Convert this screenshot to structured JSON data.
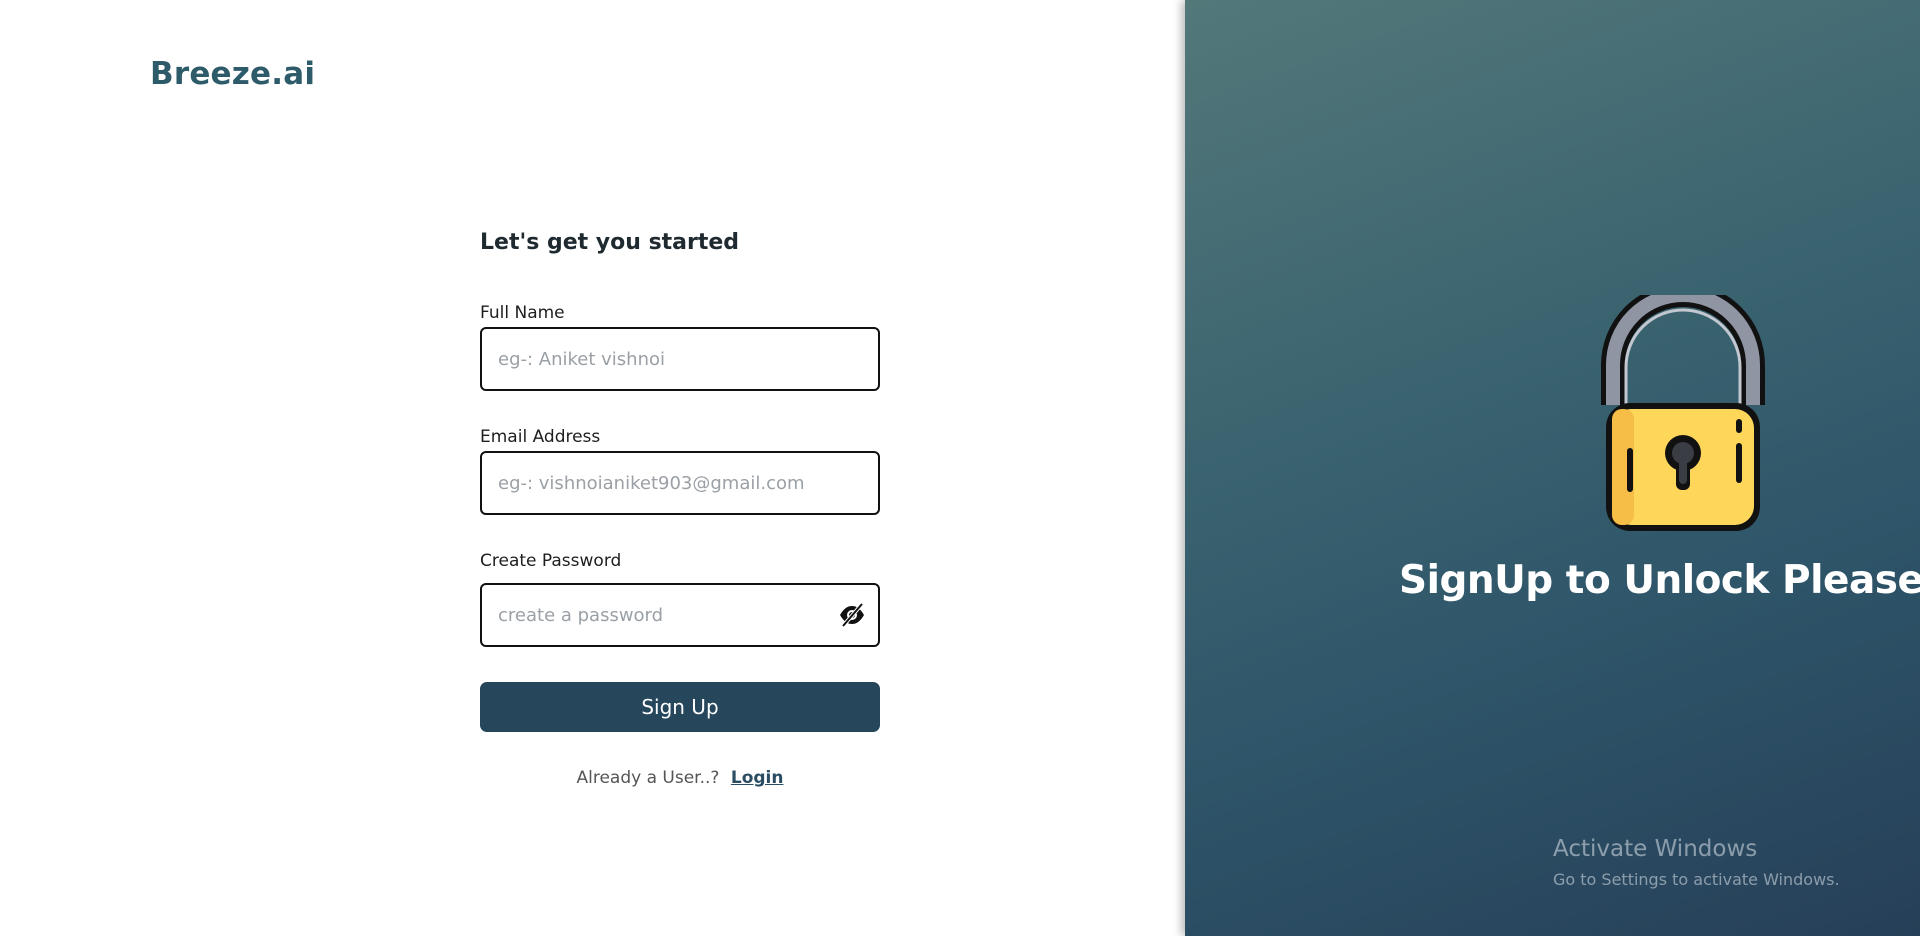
{
  "brand": {
    "name": "Breeze.ai"
  },
  "form": {
    "heading": "Let's get you started",
    "full_name": {
      "label": "Full Name",
      "placeholder": "eg-: Aniket vishnoi"
    },
    "email": {
      "label": "Email Address",
      "placeholder": "eg-: vishnoianiket903@gmail.com"
    },
    "password": {
      "label": "Create Password",
      "placeholder": "create a password",
      "toggle_icon": "eye-slash-icon"
    },
    "submit_label": "Sign Up",
    "already_text": "Already a User..?",
    "login_label": "Login"
  },
  "hero": {
    "title": "SignUp to Unlock Please",
    "icon": "padlock-icon"
  },
  "watermark": {
    "line1": "Activate Windows",
    "line2": "Go to Settings to activate Windows."
  },
  "colors": {
    "primary": "#26465b",
    "brand": "#2d5b6a",
    "lock_body": "#fdd65a",
    "lock_shackle": "#8f95a3"
  }
}
